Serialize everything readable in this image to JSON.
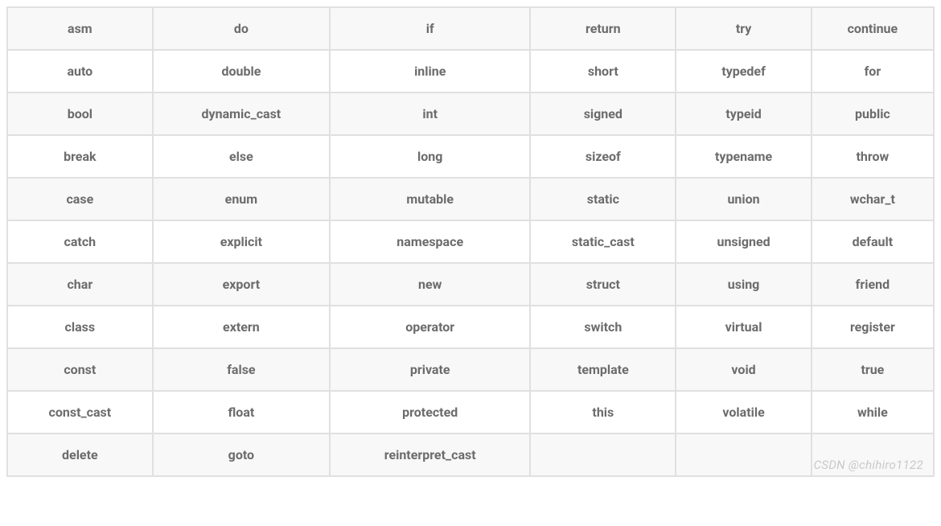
{
  "table": {
    "rows": [
      [
        "asm",
        "do",
        "if",
        "return",
        "try",
        "continue"
      ],
      [
        "auto",
        "double",
        "inline",
        "short",
        "typedef",
        "for"
      ],
      [
        "bool",
        "dynamic_cast",
        "int",
        "signed",
        "typeid",
        "public"
      ],
      [
        "break",
        "else",
        "long",
        "sizeof",
        "typename",
        "throw"
      ],
      [
        "case",
        "enum",
        "mutable",
        "static",
        "union",
        "wchar_t"
      ],
      [
        "catch",
        "explicit",
        "namespace",
        "static_cast",
        "unsigned",
        "default"
      ],
      [
        "char",
        "export",
        "new",
        "struct",
        "using",
        "friend"
      ],
      [
        "class",
        "extern",
        "operator",
        "switch",
        "virtual",
        "register"
      ],
      [
        "const",
        "false",
        "private",
        "template",
        "void",
        "true"
      ],
      [
        "const_cast",
        "float",
        "protected",
        "this",
        "volatile",
        "while"
      ],
      [
        "delete",
        "goto",
        "reinterpret_cast",
        "",
        "",
        ""
      ]
    ]
  },
  "watermark": "CSDN @chihiro1122"
}
